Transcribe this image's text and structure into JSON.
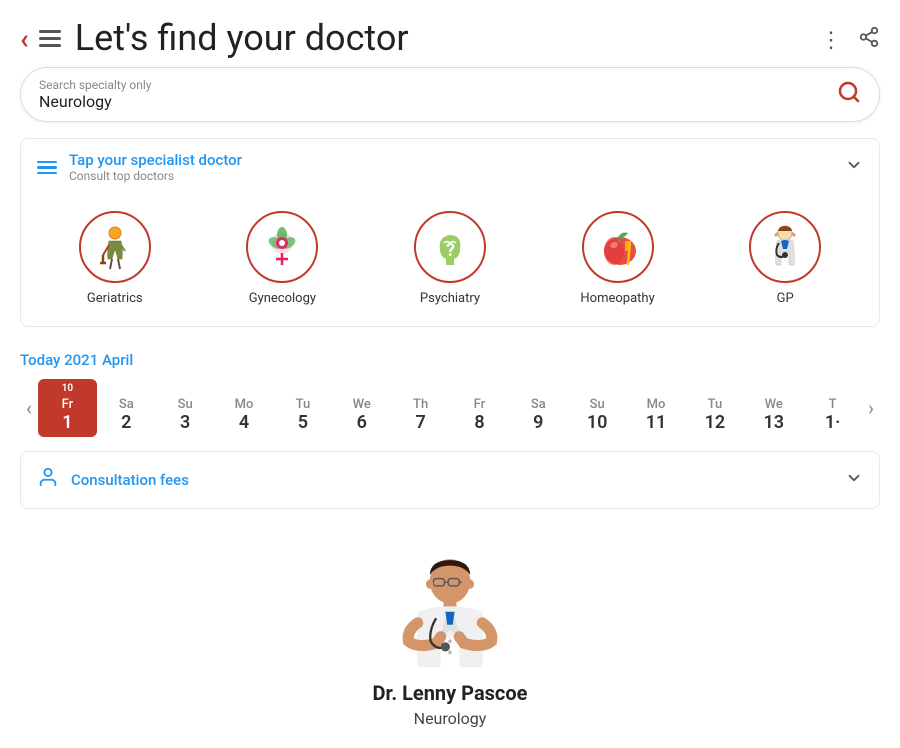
{
  "header": {
    "title": "Let's find your doctor",
    "back_icon": "‹",
    "dots_icon": "⋮",
    "share_icon": "⎋"
  },
  "search": {
    "placeholder": "Search specialty only",
    "value": "Neurology",
    "icon": "🔍"
  },
  "specialist_section": {
    "title": "Tap your specialist doctor",
    "subtitle": "Consult top doctors",
    "chevron": "∨"
  },
  "specialties": [
    {
      "label": "Geriatrics",
      "icon": "geriatrics"
    },
    {
      "label": "Gynecology",
      "icon": "gynecology"
    },
    {
      "label": "Psychiatry",
      "icon": "psychiatry"
    },
    {
      "label": "Homeopathy",
      "icon": "homeopathy"
    },
    {
      "label": "GP",
      "icon": "gp"
    }
  ],
  "date_section": {
    "title": "Today  2021 April",
    "days": [
      {
        "name": "Fr",
        "num": "1",
        "top": "10",
        "active": true
      },
      {
        "name": "Sa",
        "num": "2",
        "top": "",
        "active": false
      },
      {
        "name": "Su",
        "num": "3",
        "top": "",
        "active": false
      },
      {
        "name": "Mo",
        "num": "4",
        "top": "",
        "active": false
      },
      {
        "name": "Tu",
        "num": "5",
        "top": "",
        "active": false
      },
      {
        "name": "We",
        "num": "6",
        "top": "",
        "active": false
      },
      {
        "name": "Th",
        "num": "7",
        "top": "",
        "active": false
      },
      {
        "name": "Fr",
        "num": "8",
        "top": "",
        "active": false
      },
      {
        "name": "Sa",
        "num": "9",
        "top": "",
        "active": false
      },
      {
        "name": "Su",
        "num": "10",
        "top": "",
        "active": false
      },
      {
        "name": "Mo",
        "num": "11",
        "top": "",
        "active": false
      },
      {
        "name": "Tu",
        "num": "12",
        "top": "",
        "active": false
      },
      {
        "name": "We",
        "num": "13",
        "top": "",
        "active": false
      },
      {
        "name": "T",
        "num": "1·",
        "top": "",
        "active": false
      }
    ]
  },
  "consultation": {
    "title": "Consultation fees",
    "chevron": "∨"
  },
  "doctor": {
    "name": "Dr. Lenny Pascoe",
    "specialty": "Neurology"
  }
}
